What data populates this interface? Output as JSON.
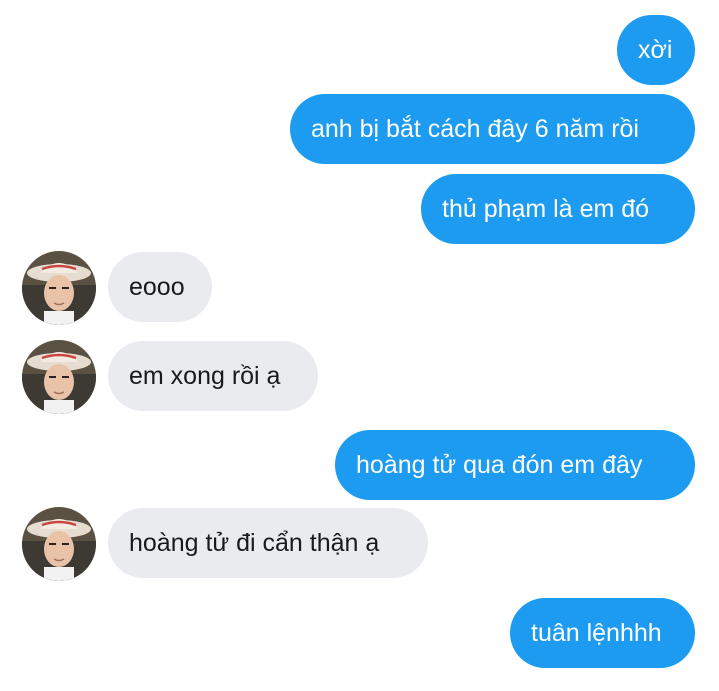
{
  "messages": [
    {
      "direction": "sent",
      "text": "xời"
    },
    {
      "direction": "sent",
      "text": "anh bị bắt cách đây 6 năm rồi"
    },
    {
      "direction": "sent",
      "text": "thủ phạm là em đó"
    },
    {
      "direction": "received",
      "text": "eooo"
    },
    {
      "direction": "received",
      "text": "em xong rồi ạ"
    },
    {
      "direction": "sent",
      "text": "hoàng tử qua đón em đây"
    },
    {
      "direction": "received",
      "text": "hoàng tử đi cẩn thận ạ"
    },
    {
      "direction": "sent",
      "text": "tuân lệnhhh"
    }
  ],
  "colors": {
    "sent_bubble": "#1d9bf0",
    "received_bubble": "#e9ebef",
    "sent_text": "#ffffff",
    "received_text": "#1a1a1a"
  },
  "avatar_icon": "contact-avatar-photo"
}
